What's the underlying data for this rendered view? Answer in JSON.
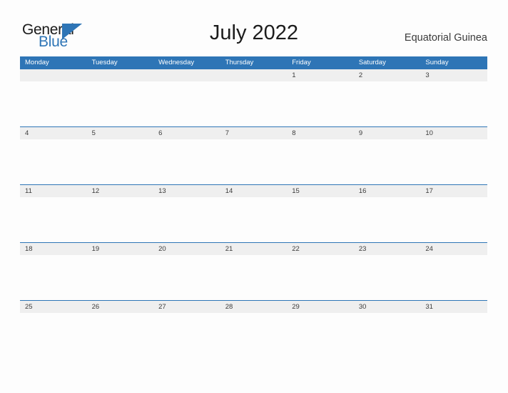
{
  "brand": {
    "name_part1": "General",
    "name_part2": "Blue",
    "flag_icon": "blue-triangle-flag-icon",
    "dark_color": "#1a1a1a",
    "accent_color": "#2e75b6"
  },
  "header": {
    "title": "July 2022",
    "subtitle": "Equatorial Guinea"
  },
  "calendar": {
    "header_bg": "#2e75b6",
    "header_text_color": "#ffffff",
    "date_band_bg": "#efefef",
    "row_divider_color": "#2e75b6",
    "weekdays": [
      "Monday",
      "Tuesday",
      "Wednesday",
      "Thursday",
      "Friday",
      "Saturday",
      "Sunday"
    ],
    "weeks": [
      [
        "",
        "",
        "",
        "",
        "1",
        "2",
        "3"
      ],
      [
        "4",
        "5",
        "6",
        "7",
        "8",
        "9",
        "10"
      ],
      [
        "11",
        "12",
        "13",
        "14",
        "15",
        "16",
        "17"
      ],
      [
        "18",
        "19",
        "20",
        "21",
        "22",
        "23",
        "24"
      ],
      [
        "25",
        "26",
        "27",
        "28",
        "29",
        "30",
        "31"
      ]
    ]
  }
}
